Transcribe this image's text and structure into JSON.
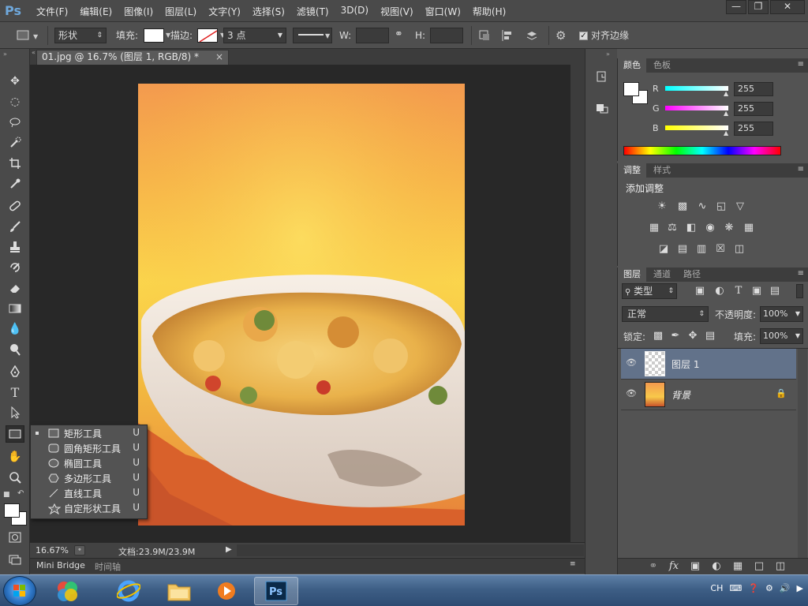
{
  "menubar": {
    "logo": "Ps",
    "items": [
      "文件(F)",
      "编辑(E)",
      "图像(I)",
      "图层(L)",
      "文字(Y)",
      "选择(S)",
      "滤镜(T)",
      "3D(D)",
      "视图(V)",
      "窗口(W)",
      "帮助(H)"
    ]
  },
  "options": {
    "mode": "形状",
    "fill_label": "填充:",
    "stroke_label": "描边:",
    "stroke_size": "3 点",
    "w_label": "W:",
    "h_label": "H:",
    "align_edges": "对齐边缘"
  },
  "document": {
    "tab_title": "01.jpg @ 16.7% (图层 1, RGB/8) *",
    "zoom": "16.67%",
    "doc_info": "文档:23.9M/23.9M"
  },
  "bottom_tabs": [
    "Mini Bridge",
    "时间轴"
  ],
  "flyout": {
    "items": [
      {
        "label": "矩形工具",
        "key": "U",
        "icon": "rect"
      },
      {
        "label": "圆角矩形工具",
        "key": "U",
        "icon": "roundrect"
      },
      {
        "label": "椭圆工具",
        "key": "U",
        "icon": "ellipse"
      },
      {
        "label": "多边形工具",
        "key": "U",
        "icon": "polygon"
      },
      {
        "label": "直线工具",
        "key": "U",
        "icon": "line"
      },
      {
        "label": "自定形状工具",
        "key": "U",
        "icon": "custom-shape"
      }
    ]
  },
  "color_panel": {
    "tabs": [
      "颜色",
      "色板"
    ],
    "channels": [
      {
        "name": "R",
        "value": "255",
        "color": "#00ffff"
      },
      {
        "name": "G",
        "value": "255",
        "color": "#ff00ff"
      },
      {
        "name": "B",
        "value": "255",
        "color": "#ffff00"
      }
    ]
  },
  "adjust_panel": {
    "tabs": [
      "调整",
      "样式"
    ],
    "title": "添加调整"
  },
  "layers_panel": {
    "tabs": [
      "图层",
      "通道",
      "路径"
    ],
    "filter_kind": "类型",
    "blend_mode": "正常",
    "opacity_label": "不透明度:",
    "opacity": "100%",
    "lock_label": "锁定:",
    "fill_label": "填充:",
    "fill": "100%",
    "layers": [
      {
        "name": "图层 1",
        "selected": true
      },
      {
        "name": "背景",
        "selected": false,
        "locked": true
      }
    ]
  },
  "taskbar": {
    "tray_lang": "CH"
  }
}
